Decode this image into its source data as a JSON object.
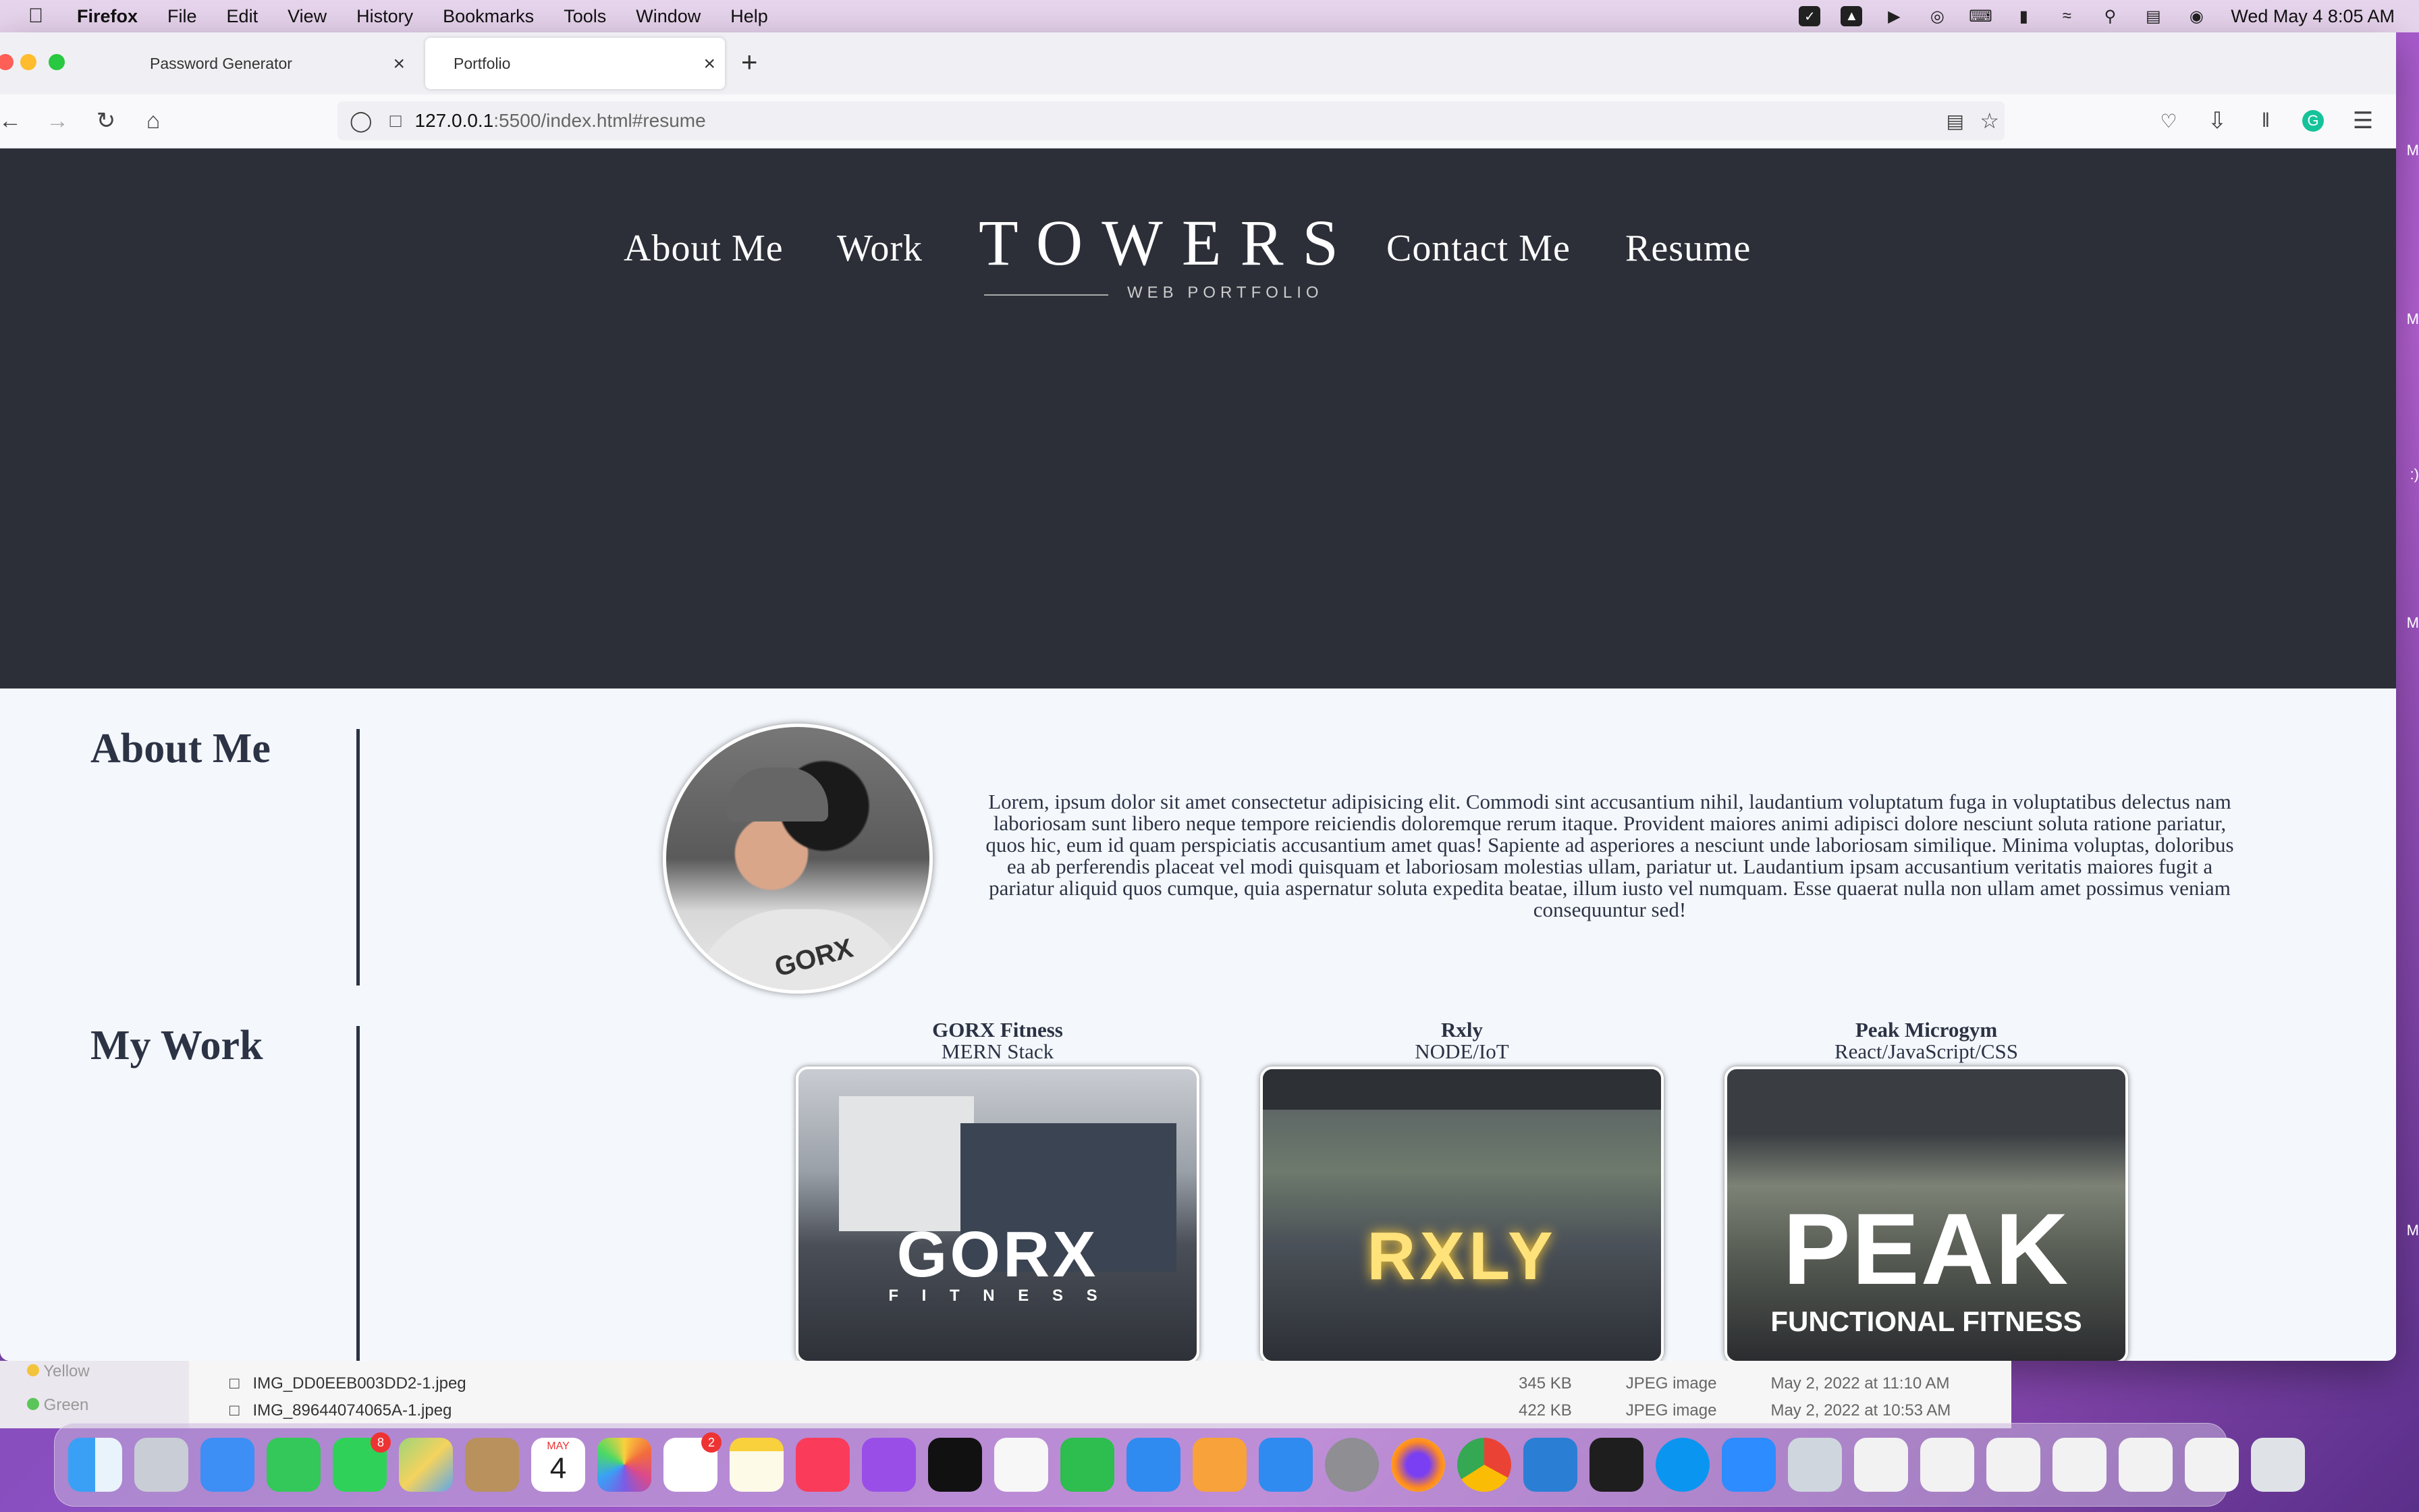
{
  "menubar": {
    "app": "Firefox",
    "items": [
      "File",
      "Edit",
      "View",
      "History",
      "Bookmarks",
      "Tools",
      "Window",
      "Help"
    ],
    "clock": "Wed May 4  8:05 AM"
  },
  "tabs": [
    {
      "label": "Password Generator"
    },
    {
      "label": "Portfolio"
    }
  ],
  "url": {
    "host": "127.0.0.1",
    "path": ":5500/index.html#resume"
  },
  "hero": {
    "nav": [
      "About Me",
      "Work",
      "Contact Me",
      "Resume"
    ],
    "brand_title": "TOWERS",
    "brand_sub": "WEB PORTFOLIO"
  },
  "about": {
    "heading": "About Me",
    "text": "Lorem, ipsum dolor sit amet consectetur adipisicing elit. Commodi sint accusantium nihil, laudantium voluptatum fuga in voluptatibus delectus nam laboriosam sunt libero neque tempore reiciendis doloremque rerum itaque. Provident maiores animi adipisci dolore nesciunt soluta ratione pariatur, quos hic, eum id quam perspiciatis accusantium amet quas! Sapiente ad asperiores a nesciunt unde laboriosam similique. Minima voluptas, doloribus ea ab perferendis placeat vel modi quisquam et laboriosam molestias ullam, pariatur ut. Laudantium ipsam accusantium veritatis maiores fugit a pariatur aliquid quos cumque, quia aspernatur soluta expedita beatae, illum iusto vel numquam. Esse quaerat nulla non ullam amet possimus veniam consequuntur sed!"
  },
  "work": {
    "heading": "My Work",
    "projects": [
      {
        "title": "GORX Fitness",
        "stack": "MERN Stack",
        "logo": "GORX",
        "logo_sub": "F I T N E S S"
      },
      {
        "title": "Rxly",
        "stack": "NODE/IoT",
        "logo": "RXLY",
        "logo_sub": ""
      },
      {
        "title": "Peak Microgym",
        "stack": "React/JavaScript/CSS",
        "logo": "PEAK",
        "logo_sub": "FUNCTIONAL FITNESS"
      }
    ]
  },
  "finder": {
    "rows": [
      {
        "name": "IMG_DD0EEB003DD2-1.jpeg",
        "size": "345 KB",
        "kind": "JPEG image",
        "date": "May 2, 2022 at 11:10 AM"
      },
      {
        "name": "IMG_89644074065A-1.jpeg",
        "size": "422 KB",
        "kind": "JPEG image",
        "date": "May 2, 2022 at 10:53 AM"
      }
    ],
    "tags": [
      "Yellow",
      "Green"
    ]
  },
  "dock": {
    "calendar_month": "MAY",
    "calendar_day": "4",
    "messages_badge": "8",
    "reminders_badge": "2"
  },
  "colors": {
    "hero_bg": "#2c2f38",
    "content_bg": "#f4f8fc",
    "heading": "#2c3345"
  }
}
